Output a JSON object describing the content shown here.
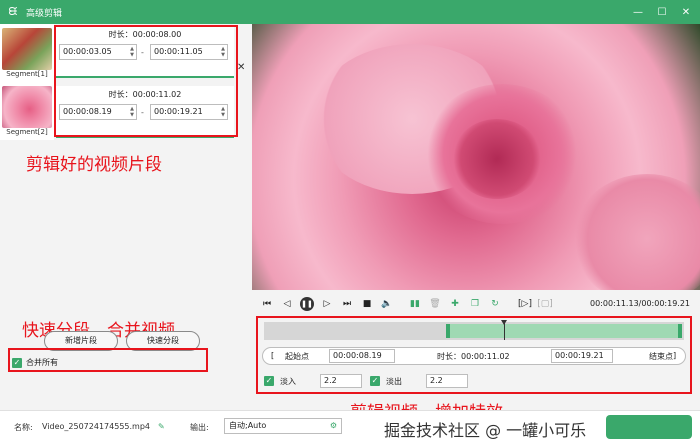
{
  "window": {
    "title": "高级剪辑",
    "logo_icon": "rabbit-icon"
  },
  "segments": [
    {
      "label": "Segment[1]",
      "duration": "时长：00:00:08.00",
      "start": "00:00:03.05",
      "end": "00:00:11.05"
    },
    {
      "label": "Segment[2]",
      "duration": "时长：00:00:11.02",
      "start": "00:00:08.19",
      "end": "00:00:19.21"
    }
  ],
  "annotations": {
    "segments_note": "剪辑好的视频片段",
    "split_note": "快速分段、合并视频",
    "effects_note": "剪辑视频，增加特效"
  },
  "buttons": {
    "add_segment": "新增片段",
    "quick_split": "快速分段",
    "merge_all": "合并所有"
  },
  "player": {
    "timecode": "00:00:11.13/00:00:19.21"
  },
  "trim": {
    "start_label": "起始点",
    "start_value": "00:00:08.19",
    "duration": "时长：00:00:11.02",
    "end_value": "00:00:19.21",
    "end_label": "结束点"
  },
  "effects": {
    "fade_in_label": "淡入",
    "fade_in_value": "2.2",
    "fade_out_label": "淡出",
    "fade_out_value": "2.2"
  },
  "bottom": {
    "name_label": "名称:",
    "filename": "Video_250724174555.mp4",
    "output_label": "输出:",
    "output_value": "自动;Auto",
    "watermark": "掘金技术社区 @ 一罐小可乐"
  },
  "colors": {
    "accent": "#3aa86b",
    "highlight": "#e8141c"
  }
}
